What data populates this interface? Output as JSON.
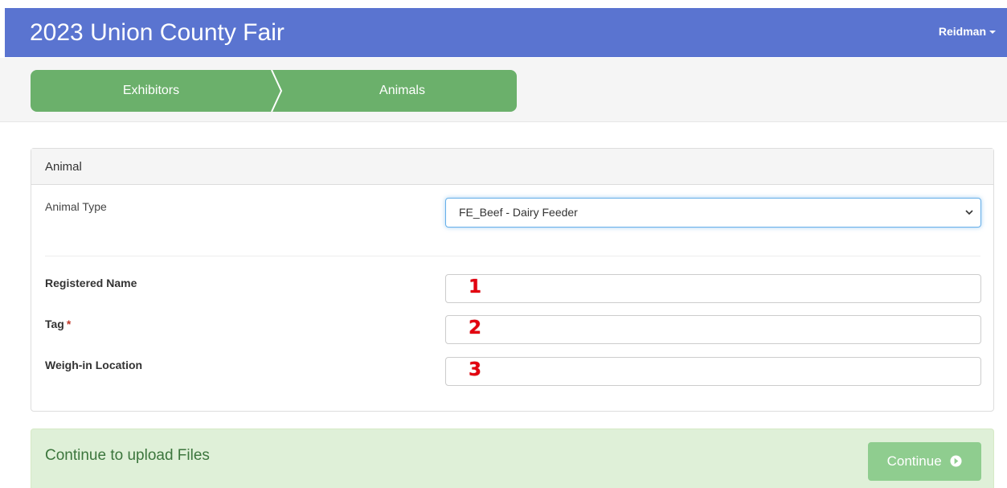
{
  "header": {
    "title": "2023 Union County Fair",
    "user_menu_label": "Reidman"
  },
  "wizard": {
    "steps": [
      {
        "label": "Exhibitors"
      },
      {
        "label": "Animals"
      }
    ]
  },
  "panel": {
    "heading": "Animal",
    "animal_type_label": "Animal Type",
    "animal_type_value": "FE_Beef - Dairy Feeder",
    "fields": [
      {
        "label": "Registered Name",
        "required": false,
        "value": "",
        "marker": "1"
      },
      {
        "label": "Tag",
        "required": true,
        "required_mark": "*",
        "value": "",
        "marker": "2"
      },
      {
        "label": "Weigh-in Location",
        "required": false,
        "value": "",
        "marker": "3"
      }
    ]
  },
  "footer": {
    "title": "Continue to upload Files",
    "continue_label": "Continue",
    "continue_icon": "arrow-circle-right-icon"
  },
  "colors": {
    "navbar": "#5a74d0",
    "wizard": "#6bb06b",
    "footer_bg": "#dff0d8",
    "continue_button": "#8fcd8f",
    "marker": "#e3000f"
  }
}
